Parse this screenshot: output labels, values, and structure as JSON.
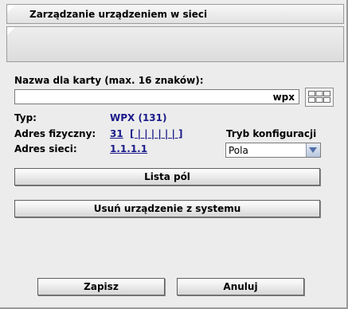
{
  "header": {
    "title": "Zarządzanie urządzeniem w sieci"
  },
  "form": {
    "name_label": "Nazwa dla karty (max. 16 znaków):",
    "name_value": "wpx",
    "type_label": "Typ:",
    "type_value": "WPX (131)",
    "physical_address_label": "Adres fizyczny:",
    "physical_address_value": "31",
    "physical_address_bits": "[ | | | | | | ]",
    "network_address_label": "Adres sieci:",
    "network_address_value": "1.1.1.1",
    "config_mode_label": "Tryb konfiguracji",
    "config_mode_value": "Pola"
  },
  "buttons": {
    "field_list": "Lista pól",
    "remove_device": "Usuń urządzenie z systemu",
    "save": "Zapisz",
    "cancel": "Anuluj"
  },
  "icons": {
    "keyboard": "keyboard-icon",
    "dropdown": "chevron-down-icon",
    "corner": "corner-icon"
  }
}
